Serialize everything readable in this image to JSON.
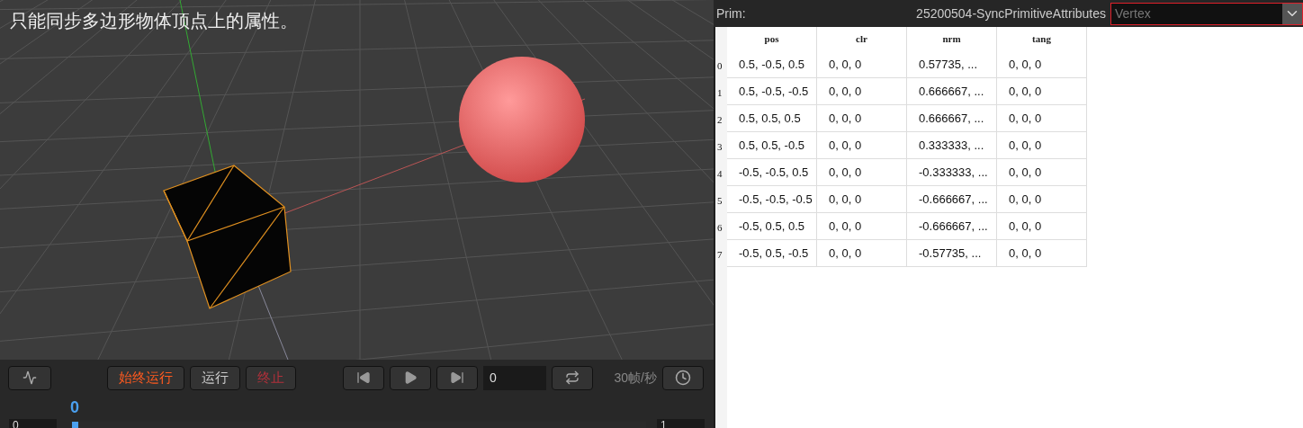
{
  "viewport": {
    "caption": "只能同步多边形物体顶点上的属性。"
  },
  "toolbar": {
    "run_always": "始终运行",
    "run": "运行",
    "stop": "终止",
    "frame": "0",
    "fps": "30帧/秒"
  },
  "timeline": {
    "current": "0",
    "start": "0",
    "end": "1",
    "level": 0
  },
  "inspector": {
    "prim_label": "Prim:",
    "prim_name": "25200504-SyncPrimitiveAttributes",
    "mode": "Vertex",
    "columns": [
      "pos",
      "clr",
      "nrm",
      "tang"
    ],
    "rows": [
      {
        "index": "0",
        "cells": [
          "0.5, -0.5, 0.5",
          "0, 0, 0",
          "0.57735, ...",
          "0, 0, 0"
        ]
      },
      {
        "index": "1",
        "cells": [
          "0.5, -0.5, -0.5",
          "0, 0, 0",
          "0.666667, ...",
          "0, 0, 0"
        ]
      },
      {
        "index": "2",
        "cells": [
          "0.5, 0.5, 0.5",
          "0, 0, 0",
          "0.666667, ...",
          "0, 0, 0"
        ]
      },
      {
        "index": "3",
        "cells": [
          "0.5, 0.5, -0.5",
          "0, 0, 0",
          "0.333333, ...",
          "0, 0, 0"
        ]
      },
      {
        "index": "4",
        "cells": [
          "-0.5, -0.5, 0.5",
          "0, 0, 0",
          "-0.333333, ...",
          "0, 0, 0"
        ]
      },
      {
        "index": "5",
        "cells": [
          "-0.5, -0.5, -0.5",
          "0, 0, 0",
          "-0.666667, ...",
          "0, 0, 0"
        ]
      },
      {
        "index": "6",
        "cells": [
          "-0.5, 0.5, 0.5",
          "0, 0, 0",
          "-0.666667, ...",
          "0, 0, 0"
        ]
      },
      {
        "index": "7",
        "cells": [
          "-0.5, 0.5, -0.5",
          "0, 0, 0",
          "-0.57735, ...",
          "0, 0, 0"
        ]
      }
    ]
  }
}
